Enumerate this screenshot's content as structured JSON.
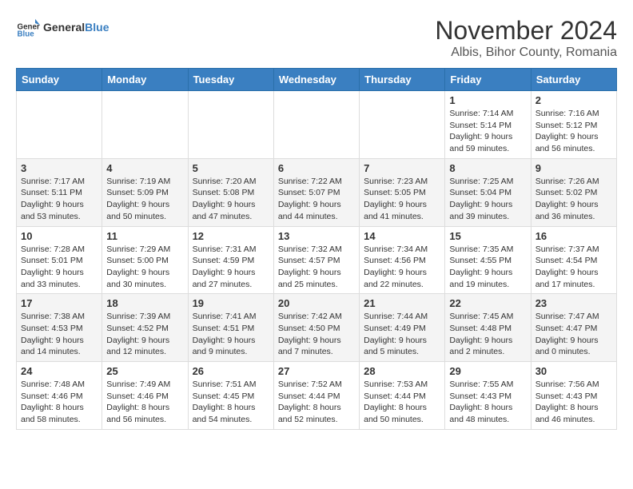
{
  "logo": {
    "general": "General",
    "blue": "Blue"
  },
  "title": "November 2024",
  "subtitle": "Albis, Bihor County, Romania",
  "days": [
    "Sunday",
    "Monday",
    "Tuesday",
    "Wednesday",
    "Thursday",
    "Friday",
    "Saturday"
  ],
  "weeks": [
    [
      {
        "date": "",
        "info": ""
      },
      {
        "date": "",
        "info": ""
      },
      {
        "date": "",
        "info": ""
      },
      {
        "date": "",
        "info": ""
      },
      {
        "date": "",
        "info": ""
      },
      {
        "date": "1",
        "info": "Sunrise: 7:14 AM\nSunset: 5:14 PM\nDaylight: 9 hours and 59 minutes."
      },
      {
        "date": "2",
        "info": "Sunrise: 7:16 AM\nSunset: 5:12 PM\nDaylight: 9 hours and 56 minutes."
      }
    ],
    [
      {
        "date": "3",
        "info": "Sunrise: 7:17 AM\nSunset: 5:11 PM\nDaylight: 9 hours and 53 minutes."
      },
      {
        "date": "4",
        "info": "Sunrise: 7:19 AM\nSunset: 5:09 PM\nDaylight: 9 hours and 50 minutes."
      },
      {
        "date": "5",
        "info": "Sunrise: 7:20 AM\nSunset: 5:08 PM\nDaylight: 9 hours and 47 minutes."
      },
      {
        "date": "6",
        "info": "Sunrise: 7:22 AM\nSunset: 5:07 PM\nDaylight: 9 hours and 44 minutes."
      },
      {
        "date": "7",
        "info": "Sunrise: 7:23 AM\nSunset: 5:05 PM\nDaylight: 9 hours and 41 minutes."
      },
      {
        "date": "8",
        "info": "Sunrise: 7:25 AM\nSunset: 5:04 PM\nDaylight: 9 hours and 39 minutes."
      },
      {
        "date": "9",
        "info": "Sunrise: 7:26 AM\nSunset: 5:02 PM\nDaylight: 9 hours and 36 minutes."
      }
    ],
    [
      {
        "date": "10",
        "info": "Sunrise: 7:28 AM\nSunset: 5:01 PM\nDaylight: 9 hours and 33 minutes."
      },
      {
        "date": "11",
        "info": "Sunrise: 7:29 AM\nSunset: 5:00 PM\nDaylight: 9 hours and 30 minutes."
      },
      {
        "date": "12",
        "info": "Sunrise: 7:31 AM\nSunset: 4:59 PM\nDaylight: 9 hours and 27 minutes."
      },
      {
        "date": "13",
        "info": "Sunrise: 7:32 AM\nSunset: 4:57 PM\nDaylight: 9 hours and 25 minutes."
      },
      {
        "date": "14",
        "info": "Sunrise: 7:34 AM\nSunset: 4:56 PM\nDaylight: 9 hours and 22 minutes."
      },
      {
        "date": "15",
        "info": "Sunrise: 7:35 AM\nSunset: 4:55 PM\nDaylight: 9 hours and 19 minutes."
      },
      {
        "date": "16",
        "info": "Sunrise: 7:37 AM\nSunset: 4:54 PM\nDaylight: 9 hours and 17 minutes."
      }
    ],
    [
      {
        "date": "17",
        "info": "Sunrise: 7:38 AM\nSunset: 4:53 PM\nDaylight: 9 hours and 14 minutes."
      },
      {
        "date": "18",
        "info": "Sunrise: 7:39 AM\nSunset: 4:52 PM\nDaylight: 9 hours and 12 minutes."
      },
      {
        "date": "19",
        "info": "Sunrise: 7:41 AM\nSunset: 4:51 PM\nDaylight: 9 hours and 9 minutes."
      },
      {
        "date": "20",
        "info": "Sunrise: 7:42 AM\nSunset: 4:50 PM\nDaylight: 9 hours and 7 minutes."
      },
      {
        "date": "21",
        "info": "Sunrise: 7:44 AM\nSunset: 4:49 PM\nDaylight: 9 hours and 5 minutes."
      },
      {
        "date": "22",
        "info": "Sunrise: 7:45 AM\nSunset: 4:48 PM\nDaylight: 9 hours and 2 minutes."
      },
      {
        "date": "23",
        "info": "Sunrise: 7:47 AM\nSunset: 4:47 PM\nDaylight: 9 hours and 0 minutes."
      }
    ],
    [
      {
        "date": "24",
        "info": "Sunrise: 7:48 AM\nSunset: 4:46 PM\nDaylight: 8 hours and 58 minutes."
      },
      {
        "date": "25",
        "info": "Sunrise: 7:49 AM\nSunset: 4:46 PM\nDaylight: 8 hours and 56 minutes."
      },
      {
        "date": "26",
        "info": "Sunrise: 7:51 AM\nSunset: 4:45 PM\nDaylight: 8 hours and 54 minutes."
      },
      {
        "date": "27",
        "info": "Sunrise: 7:52 AM\nSunset: 4:44 PM\nDaylight: 8 hours and 52 minutes."
      },
      {
        "date": "28",
        "info": "Sunrise: 7:53 AM\nSunset: 4:44 PM\nDaylight: 8 hours and 50 minutes."
      },
      {
        "date": "29",
        "info": "Sunrise: 7:55 AM\nSunset: 4:43 PM\nDaylight: 8 hours and 48 minutes."
      },
      {
        "date": "30",
        "info": "Sunrise: 7:56 AM\nSunset: 4:43 PM\nDaylight: 8 hours and 46 minutes."
      }
    ]
  ]
}
